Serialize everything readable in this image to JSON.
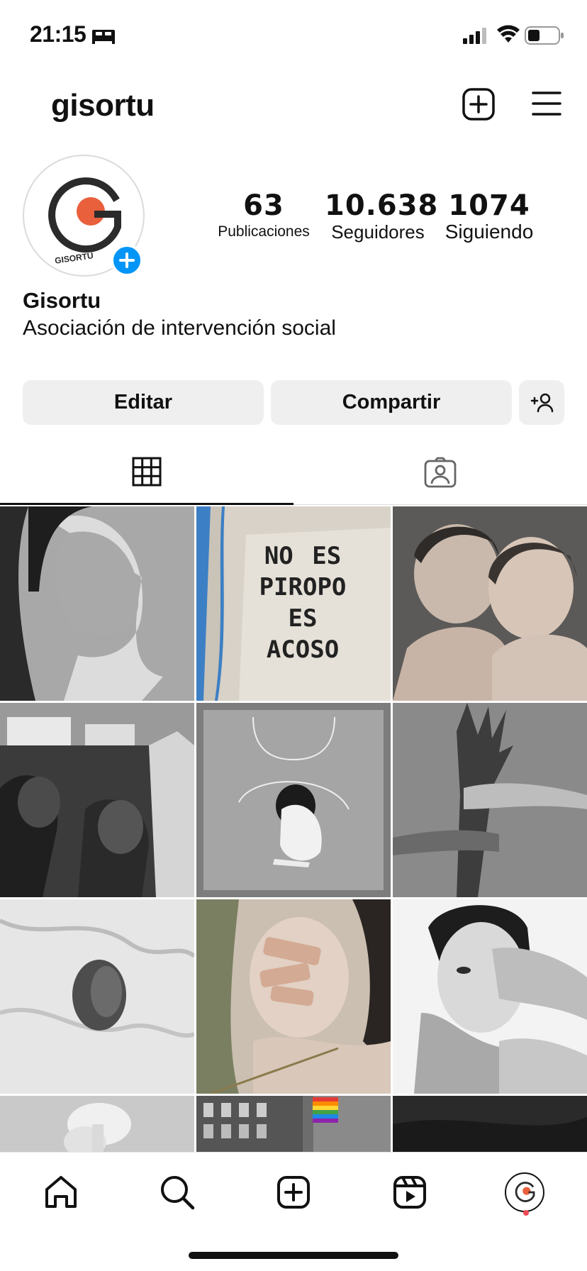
{
  "status_bar": {
    "time": "21:15",
    "icons": [
      "bed-icon",
      "signal-icon",
      "wifi-icon",
      "battery-icon"
    ]
  },
  "header": {
    "username": "gisortu",
    "icons": [
      "plus-square-icon",
      "hamburger-menu-icon"
    ]
  },
  "profile": {
    "avatar_logo_text": "GISORTU",
    "brand_colors": {
      "logo_dark": "#2b2b2b",
      "logo_orange": "#e8603c",
      "accent_blue": "#0095f6"
    },
    "stats": {
      "posts": {
        "value": "63",
        "label": "Publicaciones"
      },
      "followers": {
        "value": "10.638",
        "label": "Seguidores"
      },
      "following": {
        "value": "1074",
        "label": "Siguiendo"
      }
    },
    "display_name": "Gisortu",
    "bio": "Asociación de intervención social"
  },
  "actions": {
    "edit_label": "Editar",
    "share_label": "Compartir"
  },
  "tabs": [
    {
      "name": "grid",
      "icon": "grid-icon",
      "active": true
    },
    {
      "name": "tagged",
      "icon": "tagged-person-icon",
      "active": false
    }
  ],
  "posts": [
    {
      "id": 1,
      "overlay_text": ""
    },
    {
      "id": 2,
      "overlay_text": "NO ES PIROPO ES ACOSO"
    },
    {
      "id": 3,
      "overlay_text": ""
    },
    {
      "id": 4,
      "overlay_text": ""
    },
    {
      "id": 5,
      "overlay_text": ""
    },
    {
      "id": 6,
      "overlay_text": ""
    },
    {
      "id": 7,
      "overlay_text": ""
    },
    {
      "id": 8,
      "overlay_text": ""
    },
    {
      "id": 9,
      "overlay_text": ""
    },
    {
      "id": 10,
      "overlay_text": ""
    },
    {
      "id": 11,
      "overlay_text": ""
    },
    {
      "id": 12,
      "overlay_text": ""
    }
  ],
  "bottom_nav": [
    "home-icon",
    "search-icon",
    "create-icon",
    "reels-icon",
    "profile-icon"
  ]
}
